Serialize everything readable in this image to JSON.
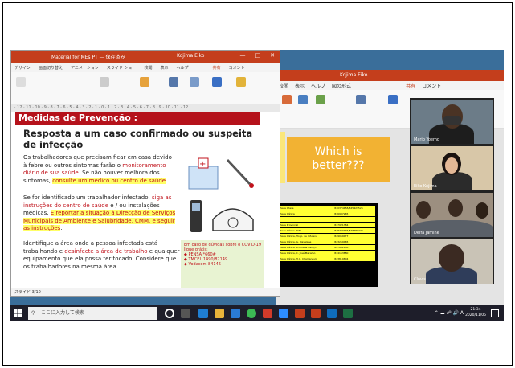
{
  "ppt_front": {
    "title": "Material for MEs PT — 保存済み",
    "user": "Kojima Eiko",
    "tabs": [
      "デザイン",
      "画面切り替え",
      "アニメーション",
      "スライド ショー",
      "校閲",
      "表示",
      "ヘルプ"
    ],
    "share": "共有",
    "comment": "コメント",
    "ruler": "· 12 · 11 · 10 · 9 · 8 · 7 · 6 · 5 · 4 · 3 · 2 · 1 · 0 · 1 · 2 · 3 · 4 · 5 · 6 · 7 · 8 · 9 · 10 · 11 · 12 ·",
    "slide": {
      "header": "Medidas de Prevenção :",
      "heading": "Resposta a um caso confirmado ou suspeita de infecção",
      "p1_a": "Os trabalhadores que precisam ficar em casa devido à febre ou outros sintomas farão o ",
      "p1_red": "monitoramento diário de sua saúde",
      "p1_b": ". Se não houver melhora dos sintomas, ",
      "p1_hl": "consulte um médico ou centro de saúde",
      "p2_a": "Se for identificado um trabalhador infectado, ",
      "p2_red1": "siga as instruções do centro de saúde",
      "p2_b": " e / ou instalações médicas. ",
      "p2_hl": "E reportar a situação à Direcção de Serviços Municipais de Ambiente e Salubridade, CMM, e seguir as instruções",
      "p3_a": "Identifique a área onde a pessoa infectada está trabalhando e ",
      "p3_red": "desinfecte a área de trabalho",
      "p3_b": " e qualquer equipamento que ela possa ter tocado. Considere que os trabalhadores na mesma área",
      "box_title": "Em caso de dúvidas sobre o COVID-19 ligue grátis:",
      "box_lines": [
        "PENSA *660#",
        "TMCEL 1490/82149",
        "Vodacom 84146"
      ]
    },
    "status": "スライド 3/10"
  },
  "ppt_back": {
    "user": "Kojima Eiko",
    "tabs": [
      "校閲",
      "表示",
      "ヘルプ",
      "図の形式"
    ],
    "share": "共有",
    "comment": "コメント",
    "which": "Which is better???",
    "contacts": [
      [
        "Sara Chefe",
        "840374158/825423526"
      ],
      [
        "Sara Clínica",
        "846987265"
      ],
      [
        "",
        ""
      ],
      [
        "Sara Provincial",
        "847921384"
      ],
      [
        "Sara Clínica HCM",
        "848799176/828780770"
      ],
      [
        "Sara Clínica, Hosp. de Infulene",
        "829059077"
      ],
      [
        "Sara Clínica, G. Mavalane",
        "823259065"
      ],
      [
        "Sara Clínica do Polana Caniço",
        "827882950"
      ],
      [
        "Sara Clínica, C. José Macamo",
        "844153880"
      ],
      [
        "Sara Clínica, H.G. Chamanculo",
        "823819804"
      ]
    ]
  },
  "video": {
    "participants": [
      "Mario Yoemo",
      "Eiko Kojima",
      "Delfa Jamine",
      "Clóvis"
    ]
  },
  "taskbar": {
    "search_placeholder": "ここに入力して検索",
    "time": "21:34",
    "date": "2020/11/05",
    "ime": "A"
  }
}
